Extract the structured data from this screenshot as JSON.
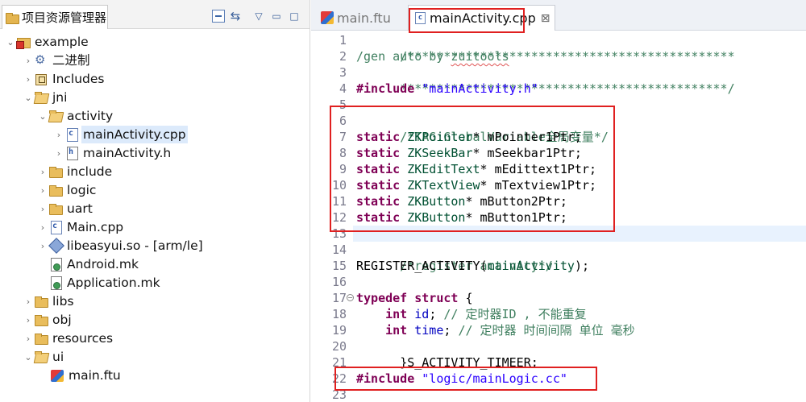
{
  "explorer": {
    "title": "项目资源管理器",
    "tools": {
      "collapse_all": "⊟",
      "link_with_editor": "⇆",
      "view_menu": "▽",
      "minimize": "▭",
      "maximize": "□"
    },
    "tree": [
      {
        "label": "example",
        "icon": "project-icon",
        "expanded": true
      },
      {
        "label": "二进制",
        "icon": "binaries-icon",
        "expanded": false
      },
      {
        "label": "Includes",
        "icon": "includes-icon",
        "expanded": false
      },
      {
        "label": "jni",
        "icon": "folder-open-icon",
        "expanded": true
      },
      {
        "label": "activity",
        "icon": "folder-open-icon",
        "expanded": true
      },
      {
        "label": "mainActivity.cpp",
        "icon": "cpp-file-icon",
        "expanded": false,
        "selected": true
      },
      {
        "label": "mainActivity.h",
        "icon": "header-file-icon",
        "expanded": false
      },
      {
        "label": "include",
        "icon": "folder-icon",
        "expanded": false
      },
      {
        "label": "logic",
        "icon": "folder-icon",
        "expanded": false
      },
      {
        "label": "uart",
        "icon": "folder-icon",
        "expanded": false
      },
      {
        "label": "Main.cpp",
        "icon": "cpp-file-icon",
        "expanded": false
      },
      {
        "label": "libeasyui.so - [arm/le]",
        "icon": "shared-library-icon",
        "expanded": false
      },
      {
        "label": "Android.mk",
        "icon": "makefile-icon"
      },
      {
        "label": "Application.mk",
        "icon": "makefile-icon"
      },
      {
        "label": "libs",
        "icon": "folder-icon",
        "expanded": false
      },
      {
        "label": "obj",
        "icon": "folder-icon",
        "expanded": false
      },
      {
        "label": "resources",
        "icon": "folder-icon",
        "expanded": false
      },
      {
        "label": "ui",
        "icon": "folder-open-icon",
        "expanded": true
      },
      {
        "label": "main.ftu",
        "icon": "ftu-file-icon"
      }
    ]
  },
  "editor": {
    "tabs": [
      {
        "label": "main.ftu",
        "active": false
      },
      {
        "label": "mainActivity.cpp",
        "active": true,
        "close": "⊠"
      }
    ],
    "line_numbers": [
      "1",
      "2",
      "3",
      "4",
      "5",
      "6",
      "7",
      "8",
      "9",
      "10",
      "11",
      "12",
      "13",
      "14",
      "15",
      "16",
      "17",
      "18",
      "19",
      "20",
      "21",
      "22",
      "23"
    ],
    "code": {
      "l1": "/*********************************************",
      "l2a": "/gen auto by ",
      "l2b": "zuitools",
      "l3": "*********************************************/",
      "l4_kw": "#include",
      "l4_str": " \"mainActivity.h\"",
      "l6": "/*TAG:GlobalVariable全局变量*/",
      "decls": [
        {
          "kw": "static",
          "type": " ZKPointer",
          "rest": "* mPointer1Ptr;"
        },
        {
          "kw": "static",
          "type": " ZKSeekBar",
          "rest": "* mSeekbar1Ptr;"
        },
        {
          "kw": "static",
          "type": " ZKEditText",
          "rest": "* mEdittext1Ptr;"
        },
        {
          "kw": "static",
          "type": " ZKTextView",
          "rest": "* mTextview1Ptr;"
        },
        {
          "kw": "static",
          "type": " ZKButton",
          "rest": "* mButton2Ptr;"
        },
        {
          "kw": "static",
          "type": " ZKButton",
          "rest": "* mButton1Ptr;"
        }
      ],
      "l14": "/*register activity*/",
      "l15a": "REGISTER_ACTIVITY(",
      "l15b": "mainActivity",
      "l15c": ");",
      "l17a": "typedef",
      "l17b": " struct",
      "l17c": " {",
      "l18a": "    int",
      "l18b": " id",
      "l18c": "; ",
      "l18d": "// 定时器ID , 不能重复",
      "l19a": "    int",
      "l19b": " time",
      "l19c": "; ",
      "l19d": "// 定时器 时间间隔 单位 毫秒",
      "l20": "}S_ACTIVITY_TIMEER;",
      "l22_kw": "#include",
      "l22_str": " \"logic/mainLogic.cc\""
    }
  }
}
